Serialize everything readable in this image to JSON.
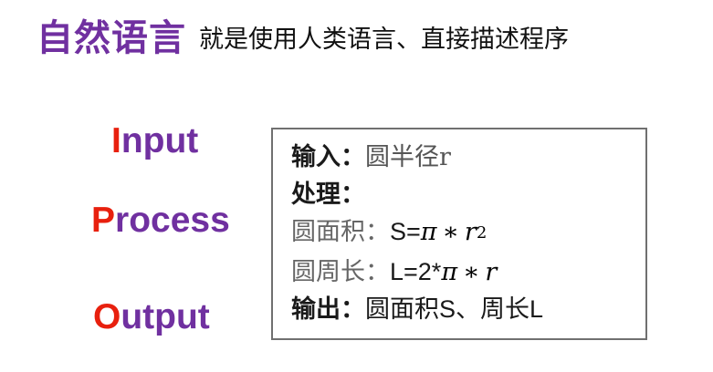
{
  "title": {
    "main": "自然语言",
    "sub": "就是使用人类语言、直接描述程序"
  },
  "ipo": {
    "input": {
      "first": "I",
      "rest": "nput"
    },
    "process": {
      "first": "P",
      "rest": "rocess"
    },
    "output": {
      "first": "O",
      "rest": "utput"
    }
  },
  "algorithm": {
    "line1": {
      "label": "输入：",
      "text": "圆半径r"
    },
    "line2": {
      "label": "处理："
    },
    "line3": {
      "label": "圆面积：",
      "prefix": "S=",
      "pi": "π",
      "star": "∗",
      "r": "r",
      "exp": "2"
    },
    "line4": {
      "label": "圆周长：",
      "prefix": "L=2*",
      "pi": "π",
      "star": "∗",
      "r": "r"
    },
    "line5": {
      "label": "输出：",
      "text": "圆面积S、周长L"
    }
  }
}
